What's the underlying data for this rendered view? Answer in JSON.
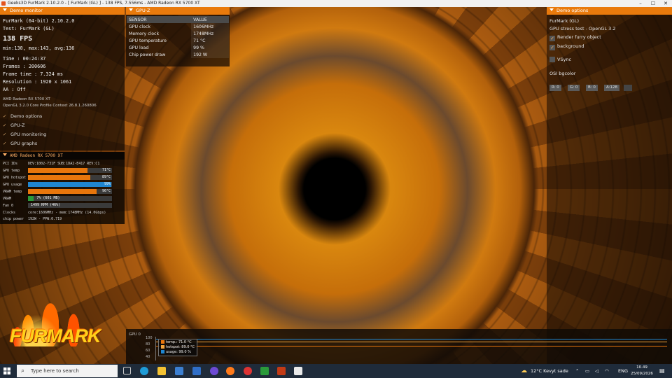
{
  "window": {
    "title": "Geeks3D FurMark 2.10.2.0 - [ FurMark (GL) ] - 138 FPS, 7.556ms - AMD Radeon RX 5700 XT",
    "controls": [
      "–",
      "☐",
      "✕"
    ]
  },
  "demo_monitor": {
    "header": "Demo monitor",
    "app_line": "FurMark (64-bit) 2.10.2.0",
    "test_line": "Test: FurMark (GL)",
    "fps": "138 FPS",
    "fps_stats": "min:130, max:143, avg:136",
    "stats": [
      "Time        : 00:24:37",
      "Frames      : 200606",
      "Frame time  : 7.324 ms",
      "Resolution  : 1920 x 1061",
      "AA          : Off"
    ],
    "gpu_name": "AMD Radeon RX 5700 XT",
    "opengl": "OpenGL 3.2.0 Core Profile Context 26.8.1.260806",
    "checks": [
      "Demo options",
      "GPU-Z",
      "GPU monitoring",
      "GPU graphs"
    ]
  },
  "amd_panel": {
    "header": "AMD Radeon RX 5700 XT",
    "pci_label": "PCI IDs",
    "pci_value": "DEV:1002-731F SUB:1DA2-E417 REV:C1",
    "rows": [
      {
        "label": "GPU temp",
        "value": "71°C",
        "fill": 0.71,
        "color": "#e8760c"
      },
      {
        "label": "GPU hotspot",
        "value": "89°C",
        "fill": 0.74,
        "color": "#e8760c"
      },
      {
        "label": "GPU usage",
        "value": "99%",
        "fill": 0.99,
        "color": "#1f86d0"
      },
      {
        "label": "VRAM temp",
        "value": "96°C",
        "fill": 0.82,
        "color": "#e8760c"
      },
      {
        "label": "VRAM",
        "value": "7% (601 MB)",
        "fill": 0.07,
        "color": "#2a9a3a"
      },
      {
        "label": "Fan 0",
        "value": "1499 RPM (46%)",
        "fill": 0.0,
        "color": "#e8760c"
      }
    ],
    "clocks_label": "Clocks",
    "clocks_value": "core:1606MHz - mem:1748MHz (14.0Gbps)",
    "power_label": "chip power",
    "power_value": "192W - PPW:0.719"
  },
  "gpuz": {
    "header": "GPU-Z",
    "col_sensor": "SENSOR",
    "col_value": "VALUE",
    "rows": [
      {
        "sensor": "GPU clock",
        "value": "1606MHz"
      },
      {
        "sensor": "Memory clock",
        "value": "1748MHz"
      },
      {
        "sensor": "GPU temperature",
        "value": "71 °C"
      },
      {
        "sensor": "GPU load",
        "value": "99 %"
      },
      {
        "sensor": "Chip power draw",
        "value": "192 W"
      }
    ]
  },
  "demo_options": {
    "header": "Demo options",
    "title": "FurMark (GL)",
    "subtitle": "GPU stress test - OpenGL 3.2",
    "render_furry": "Render furry object",
    "background": "background",
    "vsync": "VSync",
    "osi_bgcolor": "OSI bgcolor",
    "rgba": [
      "R: 0",
      "G: 0",
      "B: 0",
      "A:128"
    ]
  },
  "graph": {
    "label": "GPU 0",
    "ticks": [
      "100",
      "80",
      "60",
      "40"
    ],
    "legend": [
      {
        "text": "temp.: 71.0 °C",
        "color": "#e8760c"
      },
      {
        "text": "hotspot: 89.0 °C",
        "color": "#f2a33a"
      },
      {
        "text": "usage: 99.0 %",
        "color": "#1f86d0"
      }
    ]
  },
  "logo_text": "FURMARK",
  "taskbar": {
    "search_placeholder": "Type here to search",
    "weather": "12°C  Kevyt sade",
    "lang": "ENG",
    "time": "10.49",
    "date": "25/09/2026"
  }
}
